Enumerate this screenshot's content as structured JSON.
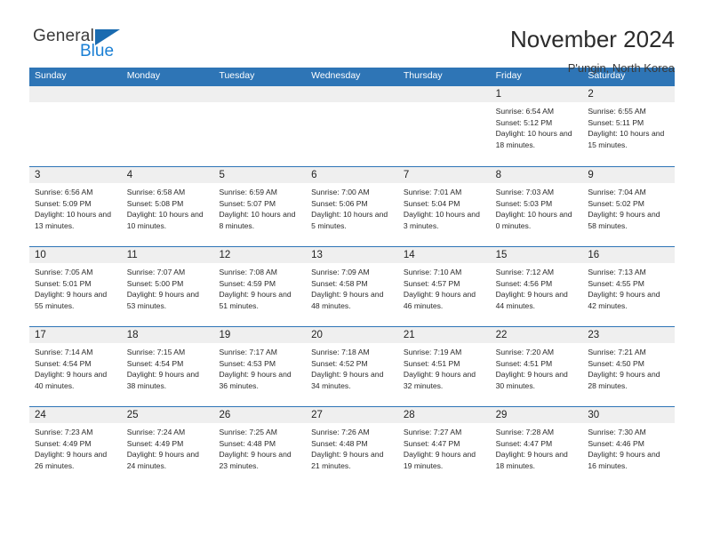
{
  "brand": {
    "name_part1": "General",
    "name_part2": "Blue",
    "triangle_color": "#1a6bb0",
    "blue_color": "#1a7fd4"
  },
  "header": {
    "month_title": "November 2024",
    "location": "P'ungin, North Korea",
    "header_bg": "#2e75b6",
    "daynum_bg": "#efefef"
  },
  "weekday_headers": [
    "Sunday",
    "Monday",
    "Tuesday",
    "Wednesday",
    "Thursday",
    "Friday",
    "Saturday"
  ],
  "labels": {
    "sunrise": "Sunrise:",
    "sunset": "Sunset:",
    "daylight": "Daylight:"
  },
  "weeks": [
    [
      {
        "day": "",
        "empty": true
      },
      {
        "day": "",
        "empty": true
      },
      {
        "day": "",
        "empty": true
      },
      {
        "day": "",
        "empty": true
      },
      {
        "day": "",
        "empty": true
      },
      {
        "day": "1",
        "sunrise": "Sunrise: 6:54 AM",
        "sunset": "Sunset: 5:12 PM",
        "daylight": "Daylight: 10 hours and 18 minutes."
      },
      {
        "day": "2",
        "sunrise": "Sunrise: 6:55 AM",
        "sunset": "Sunset: 5:11 PM",
        "daylight": "Daylight: 10 hours and 15 minutes."
      }
    ],
    [
      {
        "day": "3",
        "sunrise": "Sunrise: 6:56 AM",
        "sunset": "Sunset: 5:09 PM",
        "daylight": "Daylight: 10 hours and 13 minutes."
      },
      {
        "day": "4",
        "sunrise": "Sunrise: 6:58 AM",
        "sunset": "Sunset: 5:08 PM",
        "daylight": "Daylight: 10 hours and 10 minutes."
      },
      {
        "day": "5",
        "sunrise": "Sunrise: 6:59 AM",
        "sunset": "Sunset: 5:07 PM",
        "daylight": "Daylight: 10 hours and 8 minutes."
      },
      {
        "day": "6",
        "sunrise": "Sunrise: 7:00 AM",
        "sunset": "Sunset: 5:06 PM",
        "daylight": "Daylight: 10 hours and 5 minutes."
      },
      {
        "day": "7",
        "sunrise": "Sunrise: 7:01 AM",
        "sunset": "Sunset: 5:04 PM",
        "daylight": "Daylight: 10 hours and 3 minutes."
      },
      {
        "day": "8",
        "sunrise": "Sunrise: 7:03 AM",
        "sunset": "Sunset: 5:03 PM",
        "daylight": "Daylight: 10 hours and 0 minutes."
      },
      {
        "day": "9",
        "sunrise": "Sunrise: 7:04 AM",
        "sunset": "Sunset: 5:02 PM",
        "daylight": "Daylight: 9 hours and 58 minutes."
      }
    ],
    [
      {
        "day": "10",
        "sunrise": "Sunrise: 7:05 AM",
        "sunset": "Sunset: 5:01 PM",
        "daylight": "Daylight: 9 hours and 55 minutes."
      },
      {
        "day": "11",
        "sunrise": "Sunrise: 7:07 AM",
        "sunset": "Sunset: 5:00 PM",
        "daylight": "Daylight: 9 hours and 53 minutes."
      },
      {
        "day": "12",
        "sunrise": "Sunrise: 7:08 AM",
        "sunset": "Sunset: 4:59 PM",
        "daylight": "Daylight: 9 hours and 51 minutes."
      },
      {
        "day": "13",
        "sunrise": "Sunrise: 7:09 AM",
        "sunset": "Sunset: 4:58 PM",
        "daylight": "Daylight: 9 hours and 48 minutes."
      },
      {
        "day": "14",
        "sunrise": "Sunrise: 7:10 AM",
        "sunset": "Sunset: 4:57 PM",
        "daylight": "Daylight: 9 hours and 46 minutes."
      },
      {
        "day": "15",
        "sunrise": "Sunrise: 7:12 AM",
        "sunset": "Sunset: 4:56 PM",
        "daylight": "Daylight: 9 hours and 44 minutes."
      },
      {
        "day": "16",
        "sunrise": "Sunrise: 7:13 AM",
        "sunset": "Sunset: 4:55 PM",
        "daylight": "Daylight: 9 hours and 42 minutes."
      }
    ],
    [
      {
        "day": "17",
        "sunrise": "Sunrise: 7:14 AM",
        "sunset": "Sunset: 4:54 PM",
        "daylight": "Daylight: 9 hours and 40 minutes."
      },
      {
        "day": "18",
        "sunrise": "Sunrise: 7:15 AM",
        "sunset": "Sunset: 4:54 PM",
        "daylight": "Daylight: 9 hours and 38 minutes."
      },
      {
        "day": "19",
        "sunrise": "Sunrise: 7:17 AM",
        "sunset": "Sunset: 4:53 PM",
        "daylight": "Daylight: 9 hours and 36 minutes."
      },
      {
        "day": "20",
        "sunrise": "Sunrise: 7:18 AM",
        "sunset": "Sunset: 4:52 PM",
        "daylight": "Daylight: 9 hours and 34 minutes."
      },
      {
        "day": "21",
        "sunrise": "Sunrise: 7:19 AM",
        "sunset": "Sunset: 4:51 PM",
        "daylight": "Daylight: 9 hours and 32 minutes."
      },
      {
        "day": "22",
        "sunrise": "Sunrise: 7:20 AM",
        "sunset": "Sunset: 4:51 PM",
        "daylight": "Daylight: 9 hours and 30 minutes."
      },
      {
        "day": "23",
        "sunrise": "Sunrise: 7:21 AM",
        "sunset": "Sunset: 4:50 PM",
        "daylight": "Daylight: 9 hours and 28 minutes."
      }
    ],
    [
      {
        "day": "24",
        "sunrise": "Sunrise: 7:23 AM",
        "sunset": "Sunset: 4:49 PM",
        "daylight": "Daylight: 9 hours and 26 minutes."
      },
      {
        "day": "25",
        "sunrise": "Sunrise: 7:24 AM",
        "sunset": "Sunset: 4:49 PM",
        "daylight": "Daylight: 9 hours and 24 minutes."
      },
      {
        "day": "26",
        "sunrise": "Sunrise: 7:25 AM",
        "sunset": "Sunset: 4:48 PM",
        "daylight": "Daylight: 9 hours and 23 minutes."
      },
      {
        "day": "27",
        "sunrise": "Sunrise: 7:26 AM",
        "sunset": "Sunset: 4:48 PM",
        "daylight": "Daylight: 9 hours and 21 minutes."
      },
      {
        "day": "28",
        "sunrise": "Sunrise: 7:27 AM",
        "sunset": "Sunset: 4:47 PM",
        "daylight": "Daylight: 9 hours and 19 minutes."
      },
      {
        "day": "29",
        "sunrise": "Sunrise: 7:28 AM",
        "sunset": "Sunset: 4:47 PM",
        "daylight": "Daylight: 9 hours and 18 minutes."
      },
      {
        "day": "30",
        "sunrise": "Sunrise: 7:30 AM",
        "sunset": "Sunset: 4:46 PM",
        "daylight": "Daylight: 9 hours and 16 minutes."
      }
    ]
  ]
}
